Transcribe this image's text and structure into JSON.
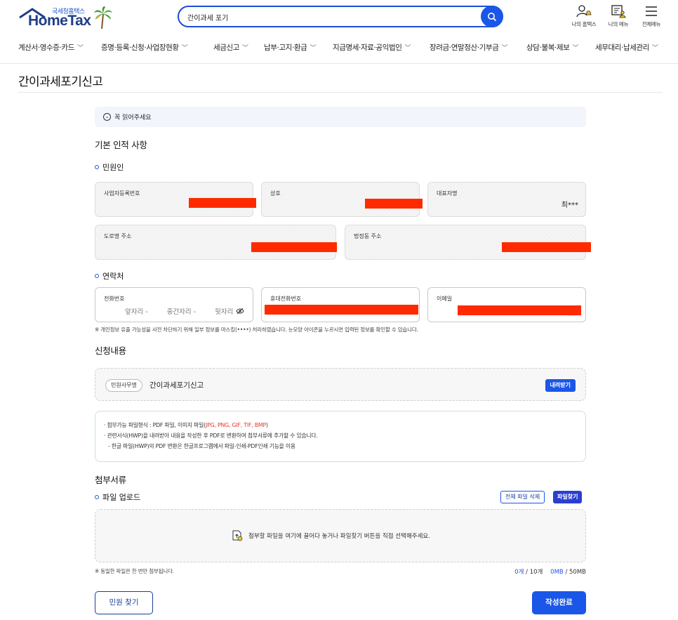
{
  "header": {
    "logo_small": "국세청홈택스",
    "logo_main": "HomeTax",
    "search_value": "간이과세 포기",
    "util": [
      {
        "label": "나의 홈택스",
        "icon": "person-bell-icon"
      },
      {
        "label": "나의 메뉴",
        "icon": "menu-person-icon"
      },
      {
        "label": "전체메뉴",
        "icon": "hamburger-icon"
      }
    ]
  },
  "nav": [
    {
      "label": "계산서·영수증·카드"
    },
    {
      "label": "증명·등록·신청·사업장현황"
    },
    {
      "label": "세금신고"
    },
    {
      "label": "납부·고지·환급"
    },
    {
      "label": "지급명세·자료·공익법인"
    },
    {
      "label": "장려금·연말정산·기부금"
    },
    {
      "label": "상담·불복·제보"
    },
    {
      "label": "세무대리·납세관리"
    }
  ],
  "page_title": "간이과세포기신고",
  "notice": "꼭 읽어주세요",
  "basic_info": {
    "heading": "기본 인적 사항",
    "applicant": {
      "heading": "민원인",
      "business_no_label": "사업자등록번호",
      "trade_name_label": "상호",
      "representative_label": "대표자명",
      "representative_value": "최***",
      "road_address_label": "도로명 주소",
      "lot_address_label": "법정동 주소"
    },
    "contact": {
      "heading": "연락처",
      "phone_label": "전화번호",
      "phone_parts": [
        "앞자리 -",
        "중간자리 -",
        "뒷자리"
      ],
      "mobile_label": "휴대전화번호",
      "email_label": "이메일",
      "note": "※ 개인정보 유출 가능성을 사전 차단하기 위해 일부 정보를 마스킹(••••) 처리하였습니다. 눈모양 아이콘을 누르시면 입력된 정보를 확인할 수 있습니다."
    }
  },
  "request": {
    "heading": "신청내용",
    "badge": "민원사무명",
    "name": "간이과세포기신고",
    "download_label": "내려받기"
  },
  "info": {
    "line1_prefix": "· 첨부가능 파일형식 : PDF 파일, 이미지 파일(",
    "line1_formats": "JPG, PNG, GIF, TIF, BMP",
    "line1_suffix": ")",
    "line2": "· 관련서식(HWP)을 내려받아 내용을 작성한 후 PDF로 변환하여 첨부서류에 추가할 수 있습니다.",
    "line3": "- 한글 파일(HWP)의 PDF 변환은 한글프로그램에서 파일-인쇄-PDF인쇄 기능을 이용"
  },
  "attachments": {
    "heading": "첨부서류",
    "upload_heading": "파일 업로드",
    "delete_all_label": "전체 파일 삭제",
    "find_file_label": "파일찾기",
    "drop_text": "첨부할 파일을 여기에 끌어다 놓거나 파일찾기 버튼을 직접 선택해주세요.",
    "note": "※ 동일한 파일은 한 번만 첨부됩니다.",
    "file_count": "0개",
    "file_max": " / 10개",
    "size_used": "0MB",
    "size_max": " / 50MB"
  },
  "footer": {
    "find_label": "민원 찾기",
    "submit_label": "작성완료"
  },
  "colors": {
    "primary": "#1a56e8",
    "navy": "#1e3e86",
    "redact": "#ff2a00"
  }
}
